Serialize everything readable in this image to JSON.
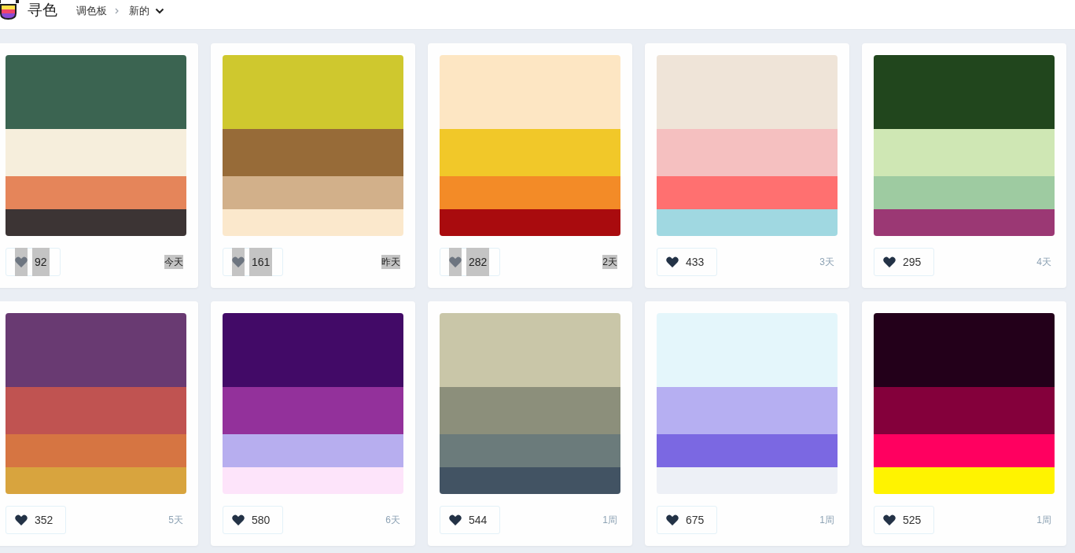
{
  "header": {
    "brand": "寻色",
    "section": "调色板",
    "filter": "新的"
  },
  "palettes": [
    {
      "stripes": [
        {
          "color": "#3b6451"
        },
        {
          "color": "#f6eedc"
        },
        {
          "color": "#e5855a"
        },
        {
          "color": "#3c3434"
        }
      ],
      "likes": "92",
      "age": "今天",
      "highlighted": true
    },
    {
      "stripes": [
        {
          "color": "#cfc82e"
        },
        {
          "color": "#976b38"
        },
        {
          "color": "#d2b08a"
        },
        {
          "color": "#fbe8cc"
        }
      ],
      "likes": "161",
      "age": "昨天",
      "highlighted": true
    },
    {
      "stripes": [
        {
          "color": "#fde6c3"
        },
        {
          "color": "#f1c829"
        },
        {
          "color": "#f38b27"
        },
        {
          "color": "#a90b0e"
        }
      ],
      "likes": "282",
      "age": "2天",
      "highlighted": true
    },
    {
      "stripes": [
        {
          "color": "#efe4d8"
        },
        {
          "color": "#f5c0c0"
        },
        {
          "color": "#ff7070"
        },
        {
          "color": "#a0d8e1"
        }
      ],
      "likes": "433",
      "age": "3天",
      "highlighted": false
    },
    {
      "stripes": [
        {
          "color": "#21461d"
        },
        {
          "color": "#cfe7b4"
        },
        {
          "color": "#9ecba1"
        },
        {
          "color": "#9b3874"
        }
      ],
      "likes": "295",
      "age": "4天",
      "highlighted": false
    },
    {
      "stripes": [
        {
          "color": "#693a72"
        },
        {
          "color": "#c05351"
        },
        {
          "color": "#d67542"
        },
        {
          "color": "#d8a43e"
        }
      ],
      "likes": "352",
      "age": "5天",
      "highlighted": false
    },
    {
      "stripes": [
        {
          "color": "#420a67"
        },
        {
          "color": "#93319b"
        },
        {
          "color": "#b7aeef"
        },
        {
          "color": "#fde4fa"
        }
      ],
      "likes": "580",
      "age": "6天",
      "highlighted": false
    },
    {
      "stripes": [
        {
          "color": "#c9c6a8"
        },
        {
          "color": "#8c8f7b"
        },
        {
          "color": "#6b7b7b"
        },
        {
          "color": "#425363"
        }
      ],
      "likes": "544",
      "age": "1周",
      "highlighted": false
    },
    {
      "stripes": [
        {
          "color": "#e4f6fb"
        },
        {
          "color": "#b6aff2"
        },
        {
          "color": "#7b68e2"
        },
        {
          "color": "#edf0f6"
        }
      ],
      "likes": "675",
      "age": "1周",
      "highlighted": false
    },
    {
      "stripes": [
        {
          "color": "#23001a"
        },
        {
          "color": "#84003b"
        },
        {
          "color": "#ff0060"
        },
        {
          "color": "#fff300"
        }
      ],
      "likes": "525",
      "age": "1周",
      "highlighted": false
    }
  ]
}
